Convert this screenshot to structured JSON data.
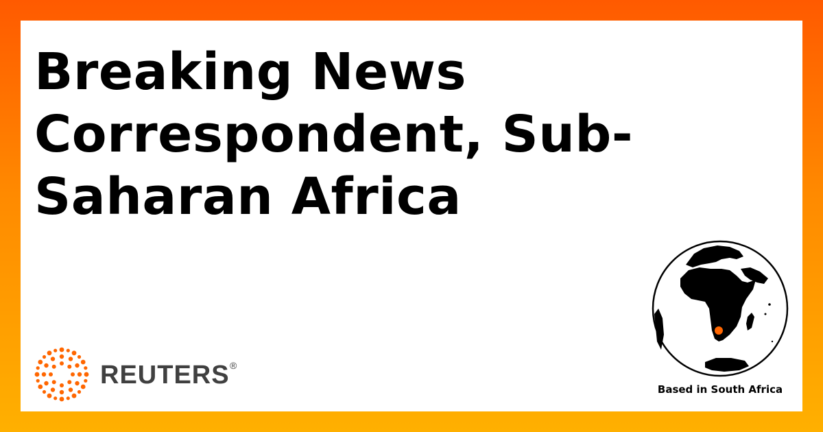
{
  "card": {
    "title": "Breaking News Correspondent, Sub-Saharan Africa",
    "location_label": "Based in South Africa"
  },
  "branding": {
    "wordmark": "REUTERS",
    "registered_mark": "®"
  },
  "colors": {
    "gradient_top": "#ff5a00",
    "gradient_bottom": "#ffb000",
    "accent": "#ff6600",
    "wordmark": "#404040",
    "text": "#000000"
  },
  "icons": {
    "logo": "reuters-dot-logo-icon",
    "globe": "globe-africa-icon",
    "marker": "location-marker-icon"
  }
}
